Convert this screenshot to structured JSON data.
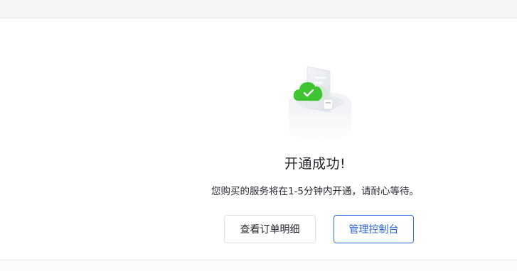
{
  "result": {
    "title": "开通成功!",
    "message": "您购买的服务将在1-5分钟内开通，请耐心等待。"
  },
  "actions": {
    "view_order": "查看订单明细",
    "console": "管理控制台"
  },
  "colors": {
    "success_green": "#3ec430",
    "primary_blue": "#2f6ee0"
  },
  "icons": {
    "illustration": "cloud-check-icon"
  }
}
